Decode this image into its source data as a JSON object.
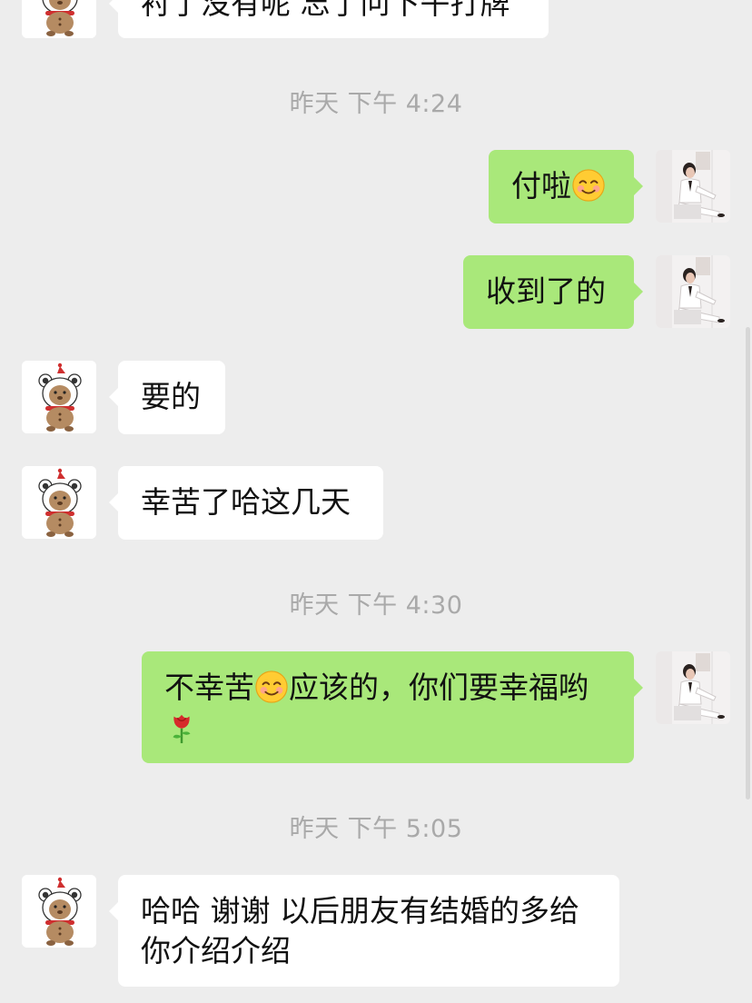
{
  "colors": {
    "background": "#ededed",
    "incoming_bubble": "#ffffff",
    "outgoing_bubble": "#a9e87a",
    "timestamp_text": "#a9a9a9"
  },
  "icons": {
    "smile": "smiling-face-emoji",
    "rose": "rose-emoji",
    "contact_avatar": "cartoon-bear-avatar",
    "self_avatar": "woman-in-white-suit-avatar"
  },
  "messages": {
    "m0_text": "衬了没有呢 忘了问下午打牌",
    "t1": "昨天 下午 4:24",
    "m1_text": "付啦",
    "m2_text": "收到了的",
    "m3_text": "要的",
    "m4_text": "幸苦了哈这几天",
    "t2": "昨天 下午 4:30",
    "m5_text_a": "不幸苦",
    "m5_text_b": "应该的，你们要幸福哟",
    "t3": "昨天 下午 5:05",
    "m6_line1": "哈哈 谢谢 以后朋友有结婚的多给",
    "m6_line2": "你介绍介绍"
  }
}
